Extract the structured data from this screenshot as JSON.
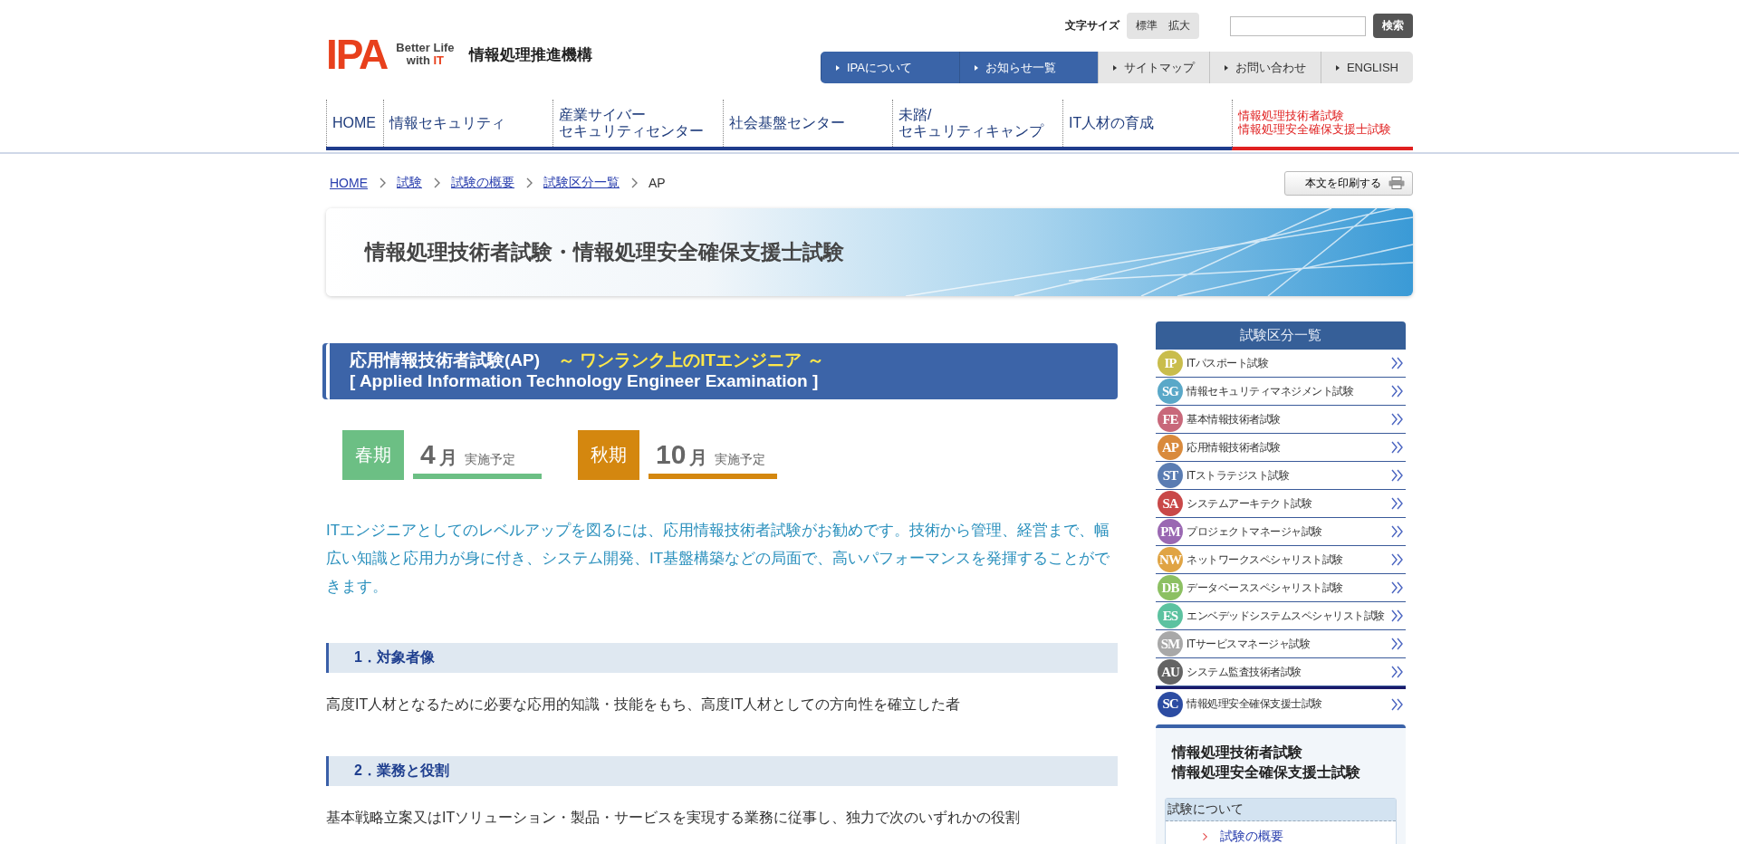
{
  "logo": {
    "mark": "IPA",
    "tagline_1": "Better Life",
    "tagline_2a": "with ",
    "tagline_2b": "IT",
    "org_name": "情報処理推進機構"
  },
  "font_size": {
    "label": "文字サイズ",
    "options": [
      {
        "label": "標準",
        "selected": false
      },
      {
        "label": "拡大",
        "selected": false
      }
    ]
  },
  "search": {
    "button": "検索"
  },
  "utility_nav": [
    {
      "label": "IPAについて",
      "kind": "primary"
    },
    {
      "label": "お知らせ一覧",
      "kind": "primary"
    },
    {
      "label": "サイトマップ",
      "kind": "secondary"
    },
    {
      "label": "お問い合わせ",
      "kind": "secondary"
    },
    {
      "label": "ENGLISH",
      "kind": "secondary"
    }
  ],
  "main_nav": [
    {
      "lines": [
        "HOME"
      ],
      "selected": false
    },
    {
      "lines": [
        "情報セキュリティ"
      ],
      "selected": false
    },
    {
      "lines": [
        "産業サイバー",
        "セキュリティセンター"
      ],
      "selected": false
    },
    {
      "lines": [
        "社会基盤センター"
      ],
      "selected": false
    },
    {
      "lines": [
        "未踏/",
        "セキュリティキャンプ"
      ],
      "selected": false
    },
    {
      "lines": [
        "IT人材の育成"
      ],
      "selected": false
    },
    {
      "lines": [
        "情報処理技術者試験",
        "情報処理安全確保支援士試験"
      ],
      "selected": true
    }
  ],
  "breadcrumb": [
    {
      "label": "HOME",
      "link": true
    },
    {
      "label": "試験",
      "link": true
    },
    {
      "label": "試験の概要",
      "link": true
    },
    {
      "label": "試験区分一覧",
      "link": true
    },
    {
      "label": "AP",
      "link": false
    }
  ],
  "print_button": "本文を印刷する",
  "banner_title": "情報処理技術者試験・情報処理安全確保支援士試験",
  "exam_title": {
    "name": "応用情報技術者試験(AP)",
    "tagline": "～ ワンランク上のITエンジニア ～",
    "english": "[ Applied Information Technology Engineer Examination ]"
  },
  "schedule": [
    {
      "season": "春期",
      "month": "4",
      "unit": "月",
      "note": "実施予定",
      "color": "#6cbf84"
    },
    {
      "season": "秋期",
      "month": "10",
      "unit": "月",
      "note": "実施予定",
      "color": "#d4870f"
    }
  ],
  "intro": "ITエンジニアとしてのレベルアップを図るには、応用情報技術者試験がお勧めです。技術から管理、経営まで、幅広い知識と応用力が身に付き、システム開発、IT基盤構築などの局面で、高いパフォーマンスを発揮することができます。",
  "sections": [
    {
      "heading": "1．対象者像",
      "body": "高度IT人材となるために必要な応用的知識・技能をもち、高度IT人材としての方向性を確立した者"
    },
    {
      "heading": "2．業務と役割",
      "body": "基本戦略立案又はITソリューション・製品・サービスを実現する業務に従事し、独力で次のいずれかの役割"
    }
  ],
  "sidebar": {
    "title": "試験区分一覧",
    "exams": [
      {
        "badge": "IP",
        "label": "ITパスポート試験",
        "color": "#c9bd4c"
      },
      {
        "badge": "SG",
        "label": "情報セキュリティマネジメント試験",
        "color": "#5aa8c8"
      },
      {
        "badge": "FE",
        "label": "基本情報技術者試験",
        "color": "#c8687a"
      },
      {
        "badge": "AP",
        "label": "応用情報技術者試験",
        "color": "#d98a3c"
      },
      {
        "badge": "ST",
        "label": "ITストラテジスト試験",
        "color": "#5a7cb2"
      },
      {
        "badge": "SA",
        "label": "システムアーキテクト試験",
        "color": "#c94848"
      },
      {
        "badge": "PM",
        "label": "プロジェクトマネージャ試験",
        "color": "#9a68b2"
      },
      {
        "badge": "NW",
        "label": "ネットワークスペシャリスト試験",
        "color": "#e0a444"
      },
      {
        "badge": "DB",
        "label": "データベーススペシャリスト試験",
        "color": "#8cc062"
      },
      {
        "badge": "ES",
        "label": "エンベデッドシステムスペシャリスト試験",
        "color": "#5cc2a0"
      },
      {
        "badge": "SM",
        "label": "ITサービスマネージャ試験",
        "color": "#a8a8a8"
      },
      {
        "badge": "AU",
        "label": "システム監査技術者試験",
        "color": "#646464"
      }
    ],
    "special": {
      "badge": "SC",
      "label": "情報処理安全確保支援士試験",
      "color": "#2c4ca2"
    },
    "box_title": [
      "情報処理技術者試験",
      "情報処理安全確保支援士試験"
    ],
    "box_section": "試験について",
    "box_links": [
      "試験の概要"
    ]
  }
}
